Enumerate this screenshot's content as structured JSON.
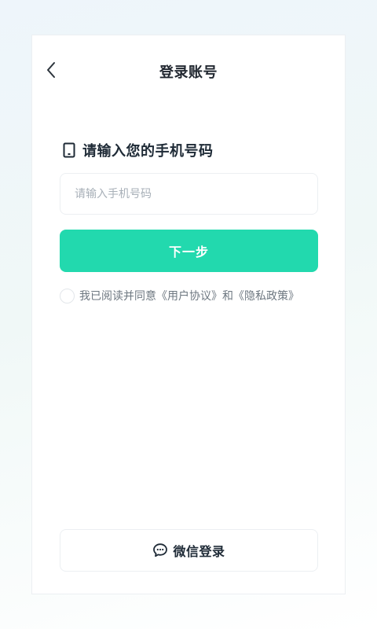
{
  "header": {
    "title": "登录账号",
    "back_icon": "chevron-left-icon"
  },
  "form": {
    "heading": "请输入您的手机号码",
    "heading_icon": "mobile-phone-icon",
    "phone_placeholder": "请输入手机号码",
    "phone_value": "",
    "next_label": "下一步"
  },
  "agreement": {
    "prefix": "我已阅读并同意",
    "user_agreement": "《用户协议》",
    "conjunction": "和",
    "privacy_policy": "《隐私政策》",
    "checked": false
  },
  "wechat_login": {
    "label": "微信登录",
    "icon": "chat-bubble-icon"
  },
  "colors": {
    "accent": "#22d9ae",
    "text_dark": "#1e2a36",
    "text_muted": "#6d7780",
    "placeholder": "#a8b0b8"
  }
}
